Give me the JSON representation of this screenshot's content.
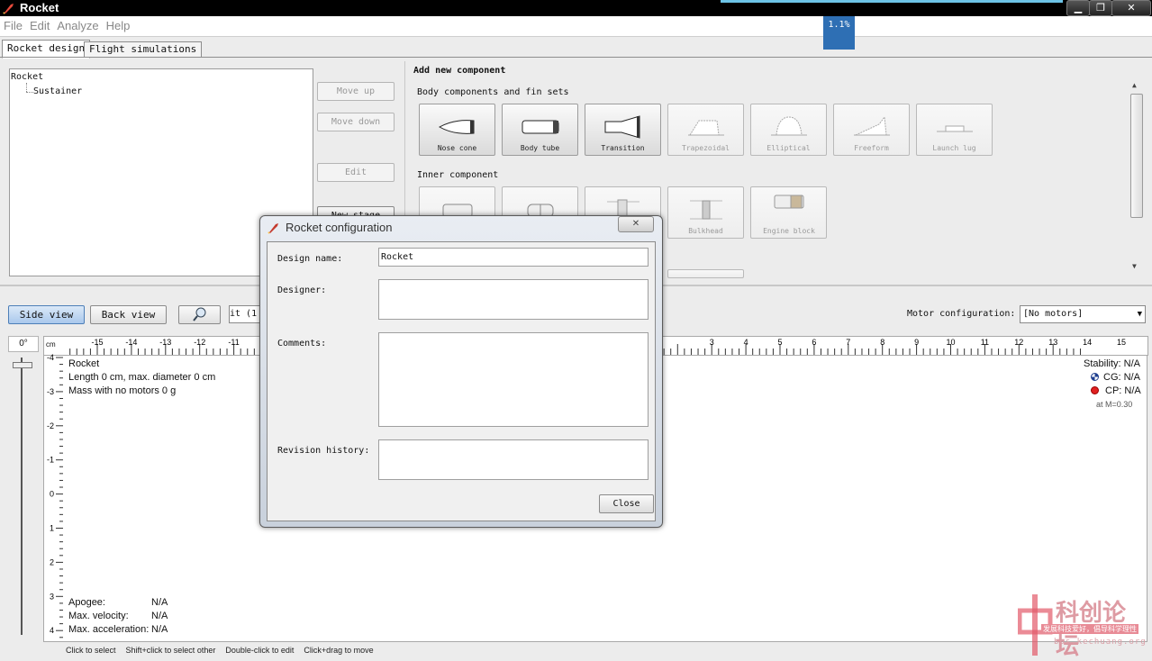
{
  "window": {
    "title": "Rocket",
    "minimize": "▁",
    "maximize": "❐",
    "close": "✕"
  },
  "menu": [
    "File",
    "Edit",
    "Analyze",
    "Help"
  ],
  "progress": "1.1%",
  "tabs": [
    {
      "label": "Rocket design",
      "active": true
    },
    {
      "label": "Flight simulations",
      "active": false
    }
  ],
  "tree": {
    "root": "Rocket",
    "child": "Sustainer"
  },
  "side_buttons": {
    "move_up": "Move up",
    "move_down": "Move down",
    "edit": "Edit",
    "new_stage": "New stage"
  },
  "add_component": {
    "title": "Add new component",
    "body_group": "Body components and fin sets",
    "body_items": [
      {
        "label": "Nose cone",
        "enabled": true,
        "icon": "nose-cone-icon"
      },
      {
        "label": "Body tube",
        "enabled": true,
        "icon": "body-tube-icon"
      },
      {
        "label": "Transition",
        "enabled": true,
        "icon": "transition-icon"
      },
      {
        "label": "Trapezoidal",
        "enabled": false,
        "icon": "trapezoidal-fin-icon"
      },
      {
        "label": "Elliptical",
        "enabled": false,
        "icon": "elliptical-fin-icon"
      },
      {
        "label": "Freeform",
        "enabled": false,
        "icon": "freeform-fin-icon"
      },
      {
        "label": "Launch lug",
        "enabled": false,
        "icon": "launch-lug-icon"
      }
    ],
    "inner_group": "Inner component",
    "inner_items": [
      {
        "label": "",
        "icon": "inner-tube-icon"
      },
      {
        "label": "",
        "icon": "coupler-icon"
      },
      {
        "label": "",
        "icon": "centering-ring-icon"
      },
      {
        "label": "Bulkhead",
        "icon": "bulkhead-icon"
      },
      {
        "label": "Engine block",
        "icon": "engine-block-icon"
      }
    ]
  },
  "view": {
    "side_view": "Side view",
    "back_view": "Back view",
    "zoom_field": "it (1",
    "motor_label": "Motor configuration:",
    "motor_value": "[No motors]",
    "rotation": "0°"
  },
  "ruler": {
    "unit": "cm",
    "h_labels": [
      "-15",
      "-14",
      "-13",
      "-12",
      "-11",
      "3",
      "4",
      "5",
      "6",
      "7",
      "8",
      "9",
      "10",
      "11",
      "12",
      "13",
      "14",
      "15"
    ],
    "v_labels": [
      "-4",
      "-3",
      "-2",
      "-1",
      "0",
      "1",
      "2",
      "3",
      "4"
    ]
  },
  "canvas_info": {
    "name": "Rocket",
    "length": "Length 0 cm, max. diameter 0 cm",
    "mass": "Mass with no motors 0 g",
    "stability": "Stability: N/A",
    "cg": "CG: N/A",
    "cp": "CP: N/A",
    "mach": "at M=0.30",
    "apogee_label": "Apogee:",
    "apogee_value": "N/A",
    "velocity_label": "Max. velocity:",
    "velocity_value": "N/A",
    "accel_label": "Max. acceleration:",
    "accel_value": "N/A"
  },
  "status_hints": [
    "Click to select",
    "Shift+click to select other",
    "Double-click to edit",
    "Click+drag to move"
  ],
  "dialog": {
    "title": "Rocket configuration",
    "close_x": "✕",
    "design_name_label": "Design name:",
    "design_name_value": "Rocket",
    "designer_label": "Designer:",
    "designer_value": "",
    "comments_label": "Comments:",
    "comments_value": "",
    "revision_label": "Revision history:",
    "revision_value": "",
    "close_button": "Close"
  },
  "watermark": {
    "title": "科创论坛",
    "tagline": "发展科技爱好，倡导科学理性",
    "url": "bbs.kechuang.org"
  },
  "colors": {
    "accent": "#2e6fb4",
    "cg_marker": "#1f3f8f",
    "cp_marker": "#e02020",
    "watermark": "#e25a6a"
  }
}
